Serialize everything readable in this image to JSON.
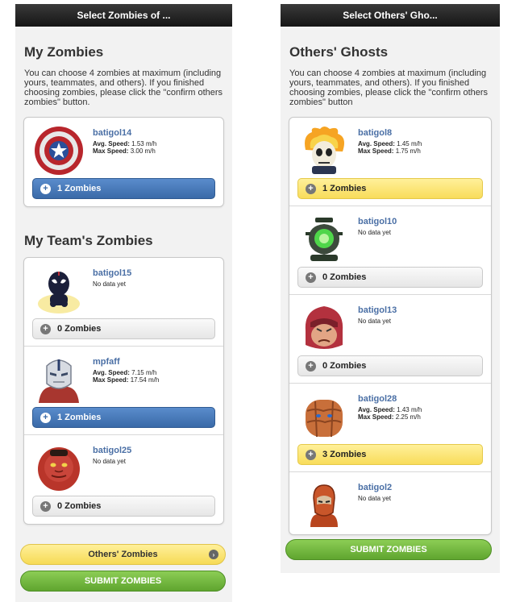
{
  "left": {
    "topbar_title": "Select Zombies of ...",
    "my_zombies": {
      "title": "My Zombies",
      "instructions": "You can choose 4 zombies at maximum (including yours, teammates, and others). If you finished choosing zombies, please click the \"confirm others zombies\" button.",
      "items": [
        {
          "name": "batigol14",
          "avg_label": "Avg. Speed:",
          "avg": "1.53 m/h",
          "max_label": "Max Speed:",
          "max": "3.00 m/h",
          "button": "1 Zombies",
          "style": "blue",
          "icon": "captain-shield-icon"
        }
      ]
    },
    "team_zombies": {
      "title": "My Team's Zombies",
      "items": [
        {
          "name": "batigol15",
          "status": "No data yet",
          "button": "0 Zombies",
          "style": "gray",
          "icon": "spiderman-icon"
        },
        {
          "name": "mpfaff",
          "avg_label": "Avg. Speed:",
          "avg": "7.15 m/h",
          "max_label": "Max Speed:",
          "max": "17.54 m/h",
          "button": "1 Zombies",
          "style": "blue",
          "icon": "ironman-icon"
        },
        {
          "name": "batigol25",
          "status": "No data yet",
          "button": "0 Zombies",
          "style": "gray",
          "icon": "hellboy-icon"
        }
      ]
    },
    "others_button": "Others' Zombies",
    "submit_button": "SUBMIT ZOMBIES"
  },
  "right": {
    "topbar_title": "Select Others' Gho...",
    "title": "Others' Ghosts",
    "instructions": "You can choose 4 zombies at maximum (including yours, teammates, and others). If you finished choosing zombies, please click the \"confirm others zombies\" button",
    "items": [
      {
        "name": "batigol8",
        "avg_label": "Avg. Speed:",
        "avg": "1.45 m/h",
        "max_label": "Max Speed:",
        "max": "1.75 m/h",
        "button": "1 Zombies",
        "style": "yellow",
        "icon": "ghost-rider-icon"
      },
      {
        "name": "batigol10",
        "status": "No data yet",
        "button": "0 Zombies",
        "style": "gray",
        "icon": "green-lantern-icon"
      },
      {
        "name": "batigol13",
        "status": "No data yet",
        "button": "0 Zombies",
        "style": "gray",
        "icon": "magneto-icon"
      },
      {
        "name": "batigol28",
        "avg_label": "Avg. Speed:",
        "avg": "1.43 m/h",
        "max_label": "Max Speed:",
        "max": "2.25 m/h",
        "button": "3 Zombies",
        "style": "yellow",
        "icon": "thing-icon"
      },
      {
        "name": "batigol2",
        "status": "No data yet",
        "button": "",
        "style": "none",
        "icon": "ultron-icon"
      }
    ],
    "submit_button": "SUBMIT ZOMBIES"
  },
  "colors": {
    "blue_button": "#4a7cbb",
    "yellow_button": "#f8dc5a",
    "green_button": "#6cb33a",
    "name_link": "#4a6fa5",
    "topbar": "#1e1e1e"
  }
}
